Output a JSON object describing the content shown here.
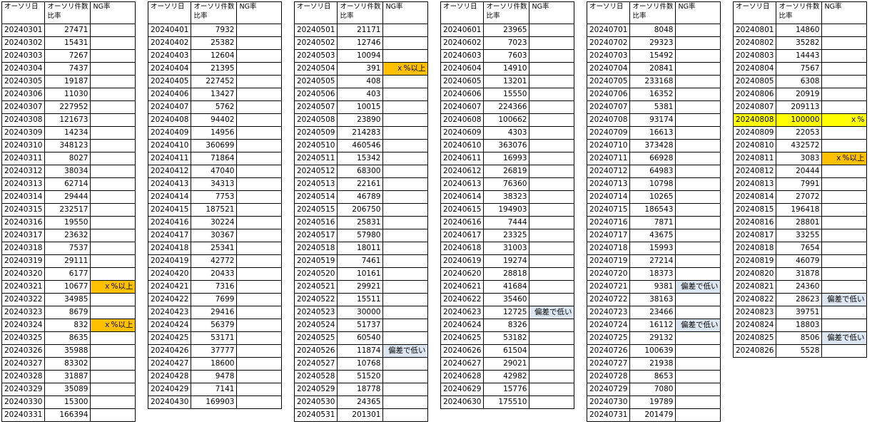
{
  "header": {
    "date": "オーソリ日",
    "count_line1": "オーソリ件数",
    "count_line2": "比率",
    "ng": "NG率"
  },
  "colors": {
    "orange": "#ffc000",
    "blue": "#dce6f1",
    "yellow": "#ffff00"
  },
  "months": [
    {
      "rows": [
        [
          "20240301",
          "27471",
          ""
        ],
        [
          "20240302",
          "15431",
          ""
        ],
        [
          "20240303",
          "7267",
          ""
        ],
        [
          "20240304",
          "7437",
          ""
        ],
        [
          "20240305",
          "19187",
          ""
        ],
        [
          "20240306",
          "11030",
          ""
        ],
        [
          "20240307",
          "227952",
          ""
        ],
        [
          "20240308",
          "121673",
          ""
        ],
        [
          "20240309",
          "14234",
          ""
        ],
        [
          "20240310",
          "348123",
          ""
        ],
        [
          "20240311",
          "8027",
          ""
        ],
        [
          "20240312",
          "38034",
          ""
        ],
        [
          "20240313",
          "62714",
          ""
        ],
        [
          "20240314",
          "29444",
          ""
        ],
        [
          "20240315",
          "232517",
          ""
        ],
        [
          "20240316",
          "19550",
          ""
        ],
        [
          "20240317",
          "23632",
          ""
        ],
        [
          "20240318",
          "7537",
          ""
        ],
        [
          "20240319",
          "29111",
          ""
        ],
        [
          "20240320",
          "6177",
          ""
        ],
        [
          "20240321",
          "10677",
          "ｘ%以上",
          "orange"
        ],
        [
          "20240322",
          "34985",
          ""
        ],
        [
          "20240323",
          "8679",
          ""
        ],
        [
          "20240324",
          "832",
          "ｘ%以上",
          "orange"
        ],
        [
          "20240325",
          "8635",
          ""
        ],
        [
          "20240326",
          "35988",
          ""
        ],
        [
          "20240327",
          "83302",
          ""
        ],
        [
          "20240328",
          "31887",
          ""
        ],
        [
          "20240329",
          "35089",
          ""
        ],
        [
          "20240330",
          "15300",
          ""
        ],
        [
          "20240331",
          "166394",
          ""
        ]
      ]
    },
    {
      "rows": [
        [
          "20240401",
          "7932",
          ""
        ],
        [
          "20240402",
          "25382",
          ""
        ],
        [
          "20240403",
          "12604",
          ""
        ],
        [
          "20240404",
          "21395",
          ""
        ],
        [
          "20240405",
          "227452",
          ""
        ],
        [
          "20240406",
          "13427",
          ""
        ],
        [
          "20240407",
          "5762",
          ""
        ],
        [
          "20240408",
          "94402",
          ""
        ],
        [
          "20240409",
          "14956",
          ""
        ],
        [
          "20240410",
          "360699",
          ""
        ],
        [
          "20240411",
          "71864",
          ""
        ],
        [
          "20240412",
          "47040",
          ""
        ],
        [
          "20240413",
          "34313",
          ""
        ],
        [
          "20240414",
          "7753",
          ""
        ],
        [
          "20240415",
          "187521",
          ""
        ],
        [
          "20240416",
          "30224",
          ""
        ],
        [
          "20240417",
          "30367",
          ""
        ],
        [
          "20240418",
          "25341",
          ""
        ],
        [
          "20240419",
          "42772",
          ""
        ],
        [
          "20240420",
          "20433",
          ""
        ],
        [
          "20240421",
          "7316",
          ""
        ],
        [
          "20240422",
          "7699",
          ""
        ],
        [
          "20240423",
          "29416",
          ""
        ],
        [
          "20240424",
          "56379",
          ""
        ],
        [
          "20240425",
          "53171",
          ""
        ],
        [
          "20240426",
          "37777",
          ""
        ],
        [
          "20240427",
          "18600",
          ""
        ],
        [
          "20240428",
          "9478",
          ""
        ],
        [
          "20240429",
          "7141",
          ""
        ],
        [
          "20240430",
          "169903",
          ""
        ]
      ]
    },
    {
      "rows": [
        [
          "20240501",
          "21171",
          ""
        ],
        [
          "20240502",
          "12746",
          ""
        ],
        [
          "20240503",
          "10094",
          ""
        ],
        [
          "20240504",
          "391",
          "ｘ%以上",
          "orange"
        ],
        [
          "20240505",
          "408",
          ""
        ],
        [
          "20240506",
          "403",
          ""
        ],
        [
          "20240507",
          "10015",
          ""
        ],
        [
          "20240508",
          "23890",
          ""
        ],
        [
          "20240509",
          "214283",
          ""
        ],
        [
          "20240510",
          "460546",
          ""
        ],
        [
          "20240511",
          "15342",
          ""
        ],
        [
          "20240512",
          "68300",
          ""
        ],
        [
          "20240513",
          "22161",
          ""
        ],
        [
          "20240514",
          "46789",
          ""
        ],
        [
          "20240515",
          "206750",
          ""
        ],
        [
          "20240516",
          "25831",
          ""
        ],
        [
          "20240517",
          "57980",
          ""
        ],
        [
          "20240518",
          "18011",
          ""
        ],
        [
          "20240519",
          "7461",
          ""
        ],
        [
          "20240520",
          "10161",
          ""
        ],
        [
          "20240521",
          "29921",
          ""
        ],
        [
          "20240522",
          "15511",
          ""
        ],
        [
          "20240523",
          "30000",
          ""
        ],
        [
          "20240524",
          "51737",
          ""
        ],
        [
          "20240525",
          "60540",
          ""
        ],
        [
          "20240526",
          "11874",
          "偏差で低い",
          "blue"
        ],
        [
          "20240527",
          "10768",
          ""
        ],
        [
          "20240528",
          "51520",
          ""
        ],
        [
          "20240529",
          "18778",
          ""
        ],
        [
          "20240530",
          "24365",
          ""
        ],
        [
          "20240531",
          "201301",
          ""
        ]
      ]
    },
    {
      "rows": [
        [
          "20240601",
          "23965",
          ""
        ],
        [
          "20240602",
          "7023",
          ""
        ],
        [
          "20240603",
          "7603",
          ""
        ],
        [
          "20240604",
          "14910",
          ""
        ],
        [
          "20240605",
          "13201",
          ""
        ],
        [
          "20240606",
          "15550",
          ""
        ],
        [
          "20240607",
          "224366",
          ""
        ],
        [
          "20240608",
          "100662",
          ""
        ],
        [
          "20240609",
          "4303",
          ""
        ],
        [
          "20240610",
          "363076",
          ""
        ],
        [
          "20240611",
          "16993",
          ""
        ],
        [
          "20240612",
          "26819",
          ""
        ],
        [
          "20240613",
          "76360",
          ""
        ],
        [
          "20240614",
          "38323",
          ""
        ],
        [
          "20240615",
          "194903",
          ""
        ],
        [
          "20240616",
          "7444",
          ""
        ],
        [
          "20240617",
          "23325",
          ""
        ],
        [
          "20240618",
          "31003",
          ""
        ],
        [
          "20240619",
          "19274",
          ""
        ],
        [
          "20240620",
          "28818",
          ""
        ],
        [
          "20240621",
          "41684",
          ""
        ],
        [
          "20240622",
          "35460",
          ""
        ],
        [
          "20240623",
          "12725",
          "偏差で低い",
          "blue"
        ],
        [
          "20240624",
          "8326",
          ""
        ],
        [
          "20240625",
          "53182",
          ""
        ],
        [
          "20240626",
          "61504",
          ""
        ],
        [
          "20240627",
          "29021",
          ""
        ],
        [
          "20240628",
          "42982",
          ""
        ],
        [
          "20240629",
          "15776",
          ""
        ],
        [
          "20240630",
          "175510",
          ""
        ]
      ]
    },
    {
      "rows": [
        [
          "20240701",
          "8048",
          ""
        ],
        [
          "20240702",
          "29323",
          ""
        ],
        [
          "20240703",
          "15492",
          ""
        ],
        [
          "20240704",
          "20841",
          ""
        ],
        [
          "20240705",
          "233168",
          ""
        ],
        [
          "20240706",
          "16352",
          ""
        ],
        [
          "20240707",
          "5381",
          ""
        ],
        [
          "20240708",
          "93174",
          ""
        ],
        [
          "20240709",
          "16613",
          ""
        ],
        [
          "20240710",
          "373428",
          ""
        ],
        [
          "20240711",
          "66928",
          ""
        ],
        [
          "20240712",
          "64983",
          ""
        ],
        [
          "20240713",
          "10798",
          ""
        ],
        [
          "20240714",
          "10265",
          ""
        ],
        [
          "20240715",
          "186543",
          ""
        ],
        [
          "20240716",
          "7871",
          ""
        ],
        [
          "20240717",
          "43675",
          ""
        ],
        [
          "20240718",
          "15993",
          ""
        ],
        [
          "20240719",
          "27214",
          ""
        ],
        [
          "20240720",
          "18373",
          ""
        ],
        [
          "20240721",
          "9381",
          "偏差で低い",
          "blue"
        ],
        [
          "20240722",
          "38163",
          ""
        ],
        [
          "20240723",
          "23466",
          ""
        ],
        [
          "20240724",
          "16112",
          "偏差で低い",
          "blue"
        ],
        [
          "20240725",
          "29132",
          ""
        ],
        [
          "20240726",
          "100639",
          ""
        ],
        [
          "20240727",
          "21938",
          ""
        ],
        [
          "20240728",
          "8653",
          ""
        ],
        [
          "20240729",
          "7080",
          ""
        ],
        [
          "20240730",
          "19789",
          ""
        ],
        [
          "20240731",
          "201479",
          ""
        ]
      ]
    },
    {
      "rows": [
        [
          "20240801",
          "14860",
          ""
        ],
        [
          "20240802",
          "35282",
          ""
        ],
        [
          "20240803",
          "14443",
          ""
        ],
        [
          "20240804",
          "7567",
          ""
        ],
        [
          "20240805",
          "6308",
          ""
        ],
        [
          "20240806",
          "20919",
          ""
        ],
        [
          "20240807",
          "209113",
          ""
        ],
        [
          "20240808",
          "100000",
          "ｘ%",
          "yellow"
        ],
        [
          "20240809",
          "22053",
          ""
        ],
        [
          "20240810",
          "432572",
          ""
        ],
        [
          "20240811",
          "3083",
          "ｘ%以上",
          "orange"
        ],
        [
          "20240812",
          "20444",
          ""
        ],
        [
          "20240813",
          "7991",
          ""
        ],
        [
          "20240814",
          "27072",
          ""
        ],
        [
          "20240815",
          "196418",
          ""
        ],
        [
          "20240816",
          "28801",
          ""
        ],
        [
          "20240817",
          "33255",
          ""
        ],
        [
          "20240818",
          "7654",
          ""
        ],
        [
          "20240819",
          "46079",
          ""
        ],
        [
          "20240820",
          "31878",
          ""
        ],
        [
          "20240821",
          "24360",
          ""
        ],
        [
          "20240822",
          "28623",
          "偏差で低い",
          "blue"
        ],
        [
          "20240823",
          "39751",
          ""
        ],
        [
          "20240824",
          "18803",
          ""
        ],
        [
          "20240825",
          "8506",
          "偏差で低い",
          "blue"
        ],
        [
          "20240826",
          "5528",
          ""
        ]
      ]
    }
  ]
}
